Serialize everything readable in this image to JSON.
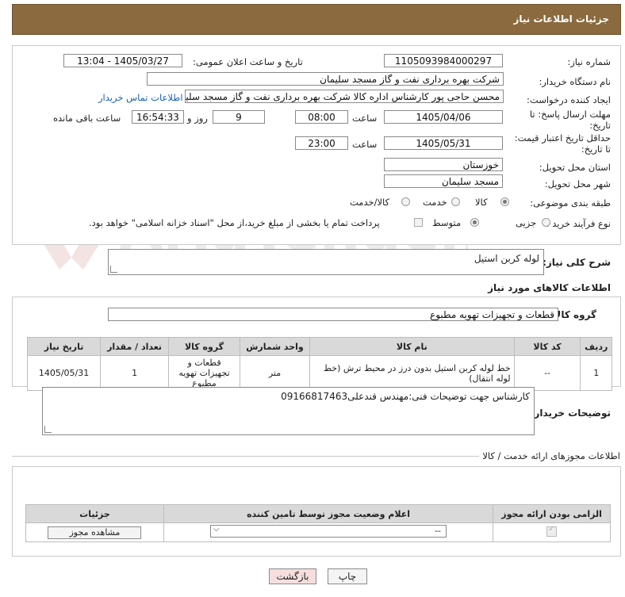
{
  "header": {
    "title": "جزئیات اطلاعات نیاز"
  },
  "form": {
    "need_number_label": "شماره نیاز:",
    "need_number": "1105093984000297",
    "announce_label": "تاریخ و ساعت اعلان عمومی:",
    "announce_value": "1405/03/27 - 13:04",
    "buyer_org_label": "نام دستگاه خریدار:",
    "buyer_org": "شرکت بهره برداری نفت و گاز مسجد سلیمان",
    "requester_label": "ایجاد کننده درخواست:",
    "requester": "محسن حاجی پور کارشناس اداره کالا  شرکت بهره برداری نفت و گاز مسجد سلیمان",
    "contact_link": "اطلاعات تماس خریدار",
    "deadline_label_1": "مهلت ارسال پاسخ: تا",
    "deadline_label_2": "تاریخ:",
    "deadline_date": "1405/04/06",
    "time_label": "ساعت",
    "deadline_time": "08:00",
    "days_value": "9",
    "days_label": "روز و",
    "remaining_time": "16:54:33",
    "remaining_label": "ساعت باقی مانده",
    "validity_label_1": "حداقل تاریخ اعتبار قیمت:",
    "validity_label_2": "تا تاریخ:",
    "validity_date": "1405/05/31",
    "validity_time": "23:00",
    "province_label": "استان محل تحویل:",
    "province": "خوزستان",
    "city_label": "شهر محل تحویل:",
    "city": "مسجد سلیمان",
    "category_label": "طبقه بندی موضوعی:",
    "category_opt1": "کالا",
    "category_opt2": "خدمت",
    "category_opt3": "کالا/خدمت",
    "process_label": "نوع فرآیند خرید :",
    "process_opt1": "جزیی",
    "process_opt2": "متوسط",
    "payment_note": "پرداخت تمام یا بخشی از مبلغ خرید،از محل \"اسناد خزانه اسلامی\" خواهد بود."
  },
  "description": {
    "label": "شرح کلی نیاز:",
    "value": "لوله کربن استیل"
  },
  "goods": {
    "section_title": "اطلاعات کالاهای مورد نیاز",
    "group_label": "گروه کالا:",
    "group_value": "قطعات و تجهیزات تهویه مطبوع",
    "columns": [
      "ردیف",
      "کد کالا",
      "نام کالا",
      "واحد شمارش",
      "گروه کالا",
      "تعداد / مقدار",
      "تاریخ نیاز"
    ],
    "rows": [
      {
        "row": "1",
        "code": "--",
        "name": "خط لوله کربن استیل بدون درز در محیط ترش (خط لوله انتقال)",
        "unit": "متر",
        "group": "قطعات و تجهیزات تهویه مطبوع",
        "qty": "1",
        "date": "1405/05/31"
      }
    ]
  },
  "buyer_notes": {
    "label": "توضیحات خریدار:",
    "value": "کارشناس جهت توضیحات فنی:مهندس قندعلی09166817463"
  },
  "permits": {
    "section_title": "اطلاعات مجوزهای ارائه خدمت / کالا",
    "columns": [
      "الزامی بودن ارائه مجوز",
      "اعلام وضعیت مجوز توسط تامین کننده",
      "جزئیات"
    ],
    "select_value": "--",
    "view_button": "مشاهده مجوز"
  },
  "buttons": {
    "print": "چاپ",
    "back": "بازگشت"
  },
  "watermark": {
    "text": "AriaTender.neT"
  },
  "colors": {
    "header": "#8a6a3e",
    "link": "#1a5fb4",
    "table_header": "#d9d9d9"
  }
}
